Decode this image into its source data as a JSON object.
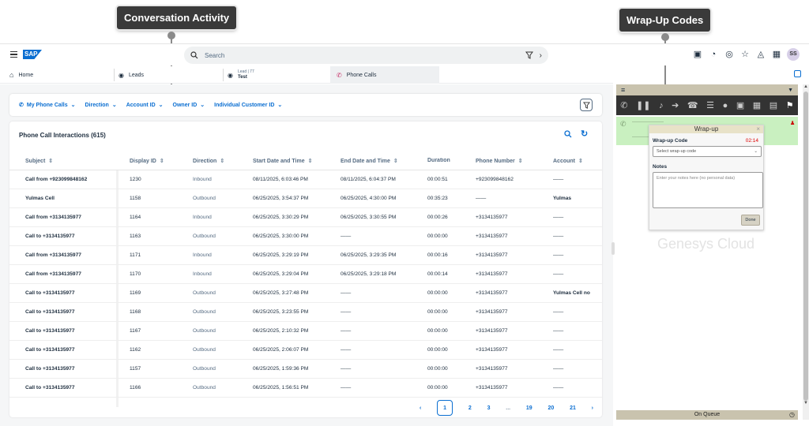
{
  "callouts": {
    "left": "Conversation Activity",
    "right": "Wrap-Up Codes"
  },
  "shell": {
    "logo": "SAP",
    "search_placeholder": "Search",
    "avatar": "SS"
  },
  "tabs": [
    {
      "label": "Home"
    },
    {
      "label": "Leads"
    },
    {
      "label": "Lead | 77",
      "sub": "Test"
    },
    {
      "label": "Phone Calls"
    }
  ],
  "filters": [
    "My Phone Calls",
    "Direction",
    "Account ID",
    "Owner ID",
    "Individual Customer ID"
  ],
  "table": {
    "title": "Phone Call Interactions (615)",
    "columns": [
      "Subject",
      "Display ID",
      "Direction",
      "Start Date and Time",
      "End Date and Time",
      "Duration",
      "Phone Number",
      "Account"
    ],
    "rows": [
      [
        "Call from +923099848162",
        "1230",
        "Inbound",
        "08/11/2025, 6:03:46 PM",
        "08/11/2025, 6:04:37 PM",
        "00:00:51",
        "+923099848162",
        "——"
      ],
      [
        "Yulmas Cell",
        "1158",
        "Outbound",
        "06/25/2025, 3:54:37 PM",
        "06/25/2025, 4:30:00 PM",
        "00:35:23",
        "——",
        "Yulmas"
      ],
      [
        "Call from +3134135977",
        "1164",
        "Inbound",
        "06/25/2025, 3:30:29 PM",
        "06/25/2025, 3:30:55 PM",
        "00:00:26",
        "+3134135977",
        "——"
      ],
      [
        "Call to +3134135977",
        "1163",
        "Outbound",
        "06/25/2025, 3:30:00 PM",
        "——",
        "00:00:00",
        "+3134135977",
        "——"
      ],
      [
        "Call from +3134135977",
        "1171",
        "Inbound",
        "06/25/2025, 3:29:19 PM",
        "06/25/2025, 3:29:35 PM",
        "00:00:16",
        "+3134135977",
        "——"
      ],
      [
        "Call from +3134135977",
        "1170",
        "Inbound",
        "06/25/2025, 3:29:04 PM",
        "06/25/2025, 3:29:18 PM",
        "00:00:14",
        "+3134135977",
        "——"
      ],
      [
        "Call to +3134135977",
        "1169",
        "Outbound",
        "06/25/2025, 3:27:48 PM",
        "——",
        "00:00:00",
        "+3134135977",
        "Yulmas Cell no"
      ],
      [
        "Call to +3134135977",
        "1168",
        "Outbound",
        "06/25/2025, 3:23:55 PM",
        "——",
        "00:00:00",
        "+3134135977",
        "——"
      ],
      [
        "Call to +3134135977",
        "1167",
        "Outbound",
        "06/25/2025, 2:10:32 PM",
        "——",
        "00:00:00",
        "+3134135977",
        "——"
      ],
      [
        "Call to +3134135977",
        "1162",
        "Outbound",
        "06/25/2025, 2:06:07 PM",
        "——",
        "00:00:00",
        "+3134135977",
        "——"
      ],
      [
        "Call to +3134135977",
        "1157",
        "Outbound",
        "06/25/2025, 1:59:36 PM",
        "——",
        "00:00:00",
        "+3134135977",
        "——"
      ],
      [
        "Call to +3134135977",
        "1166",
        "Outbound",
        "06/25/2025, 1:56:51 PM",
        "——",
        "00:00:00",
        "+3134135977",
        "——"
      ]
    ]
  },
  "pagination": {
    "pages": [
      "1",
      "2",
      "3",
      "...",
      "19",
      "20",
      "21"
    ],
    "current": "1"
  },
  "genesys": {
    "wrapup_title": "Wrap-up",
    "wrapup_code_label": "Wrap-up Code",
    "timer": "02:14",
    "select_placeholder": "Select wrap-up code",
    "notes_label": "Notes",
    "notes_placeholder": "Enter your notes here (no personal data)",
    "done": "Done",
    "watermark": "Genesys Cloud",
    "status": "On Queue"
  }
}
